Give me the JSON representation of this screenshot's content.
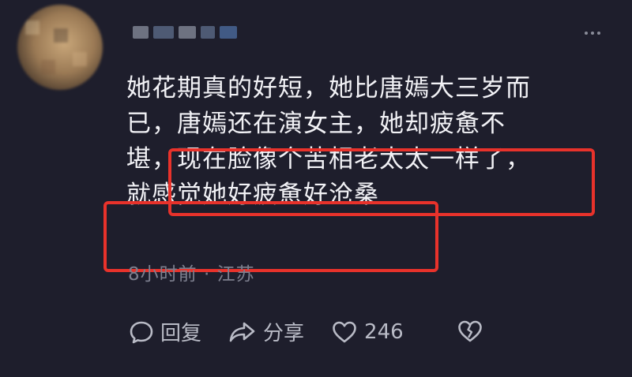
{
  "comment": {
    "author_name": "",
    "lines": [
      "她花期真的好短，她比唐嫣大三岁而",
      "已，唐嫣还在演女主，她却疲惫不",
      "堪，现在脸像个苦相老太太一样了，",
      "就感觉她好疲惫好沧桑"
    ],
    "time": "8小时前",
    "separator": "·",
    "location": "江苏"
  },
  "actions": {
    "reply_label": "回复",
    "share_label": "分享",
    "like_count": "246"
  },
  "colors": {
    "background": "#1e1e2c",
    "highlight_box": "#e8322b",
    "text": "#f2f2f6",
    "meta": "#7d7f8e"
  },
  "icons": {
    "reply": "reply-bubble-icon",
    "share": "share-arrow-icon",
    "like": "heart-icon",
    "dislike": "broken-heart-icon",
    "more": "more-dots-icon"
  }
}
